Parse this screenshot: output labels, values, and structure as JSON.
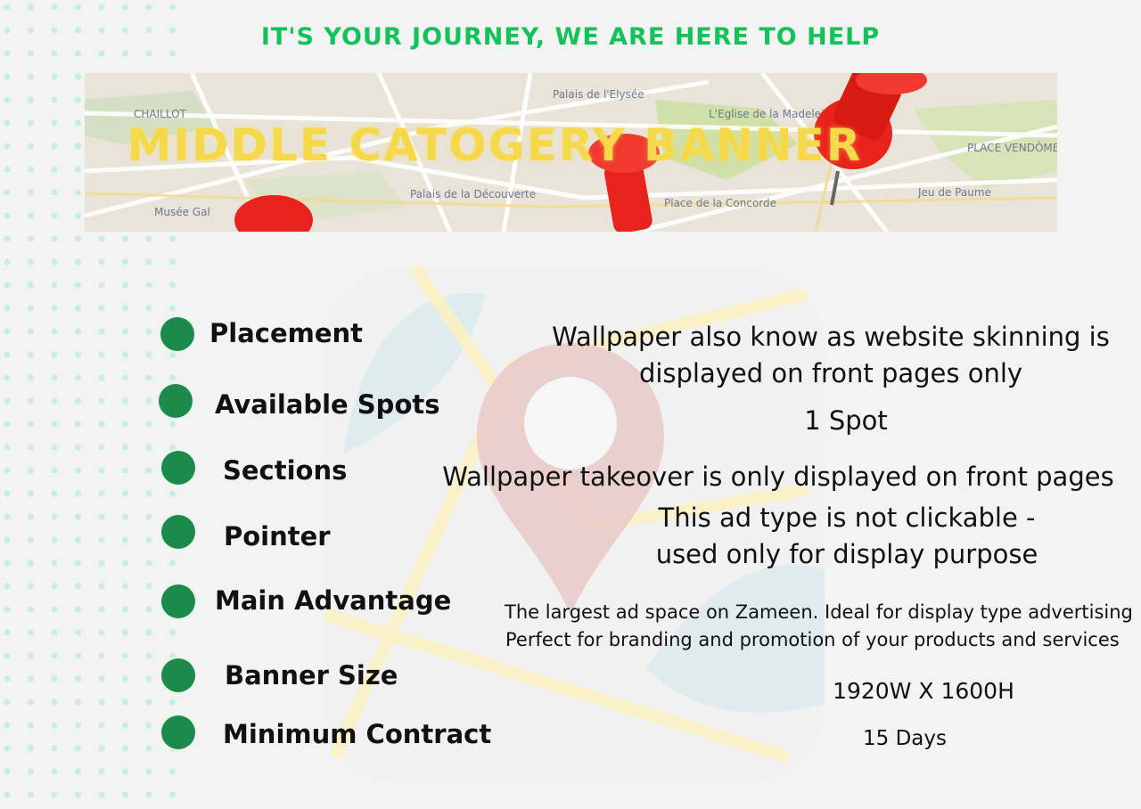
{
  "header": {
    "tagline": "IT'S YOUR JOURNEY, WE ARE HERE TO HELP"
  },
  "banner": {
    "title": "MIDDLE CATOGERY BANNER",
    "map_labels": [
      "CHAILLOT",
      "Palais de l'Elysée",
      "L'Eglise de la Madeleine",
      "PLACE VENDÔME",
      "Palais de la Découverte",
      "Place de la Concorde",
      "Jeu de Paume",
      "Musée Gal"
    ]
  },
  "specs": [
    {
      "label": "Placement",
      "value": [
        "Wallpaper also know as website skinning is",
        "displayed on front pages only"
      ]
    },
    {
      "label": "Available Spots",
      "value": [
        "1 Spot"
      ]
    },
    {
      "label": "Sections",
      "value": [
        "Wallpaper takeover is only displayed on front pages"
      ]
    },
    {
      "label": "Pointer",
      "value": [
        "This ad type is not clickable -",
        "used only for display purpose"
      ]
    },
    {
      "label": "Main Advantage",
      "value": [
        "The largest ad space on Zameen. Ideal for display type advertising",
        "Perfect for branding and promotion of your products and services"
      ]
    },
    {
      "label": "Banner Size",
      "value": [
        "1920W X 1600H"
      ]
    },
    {
      "label": "Minimum Contract",
      "value": [
        "15 Days"
      ]
    }
  ],
  "colors": {
    "tagline": "#13c35a",
    "bullet": "#1b8a4a",
    "banner_title": "#f5d94a",
    "pin": "#e8231e"
  }
}
